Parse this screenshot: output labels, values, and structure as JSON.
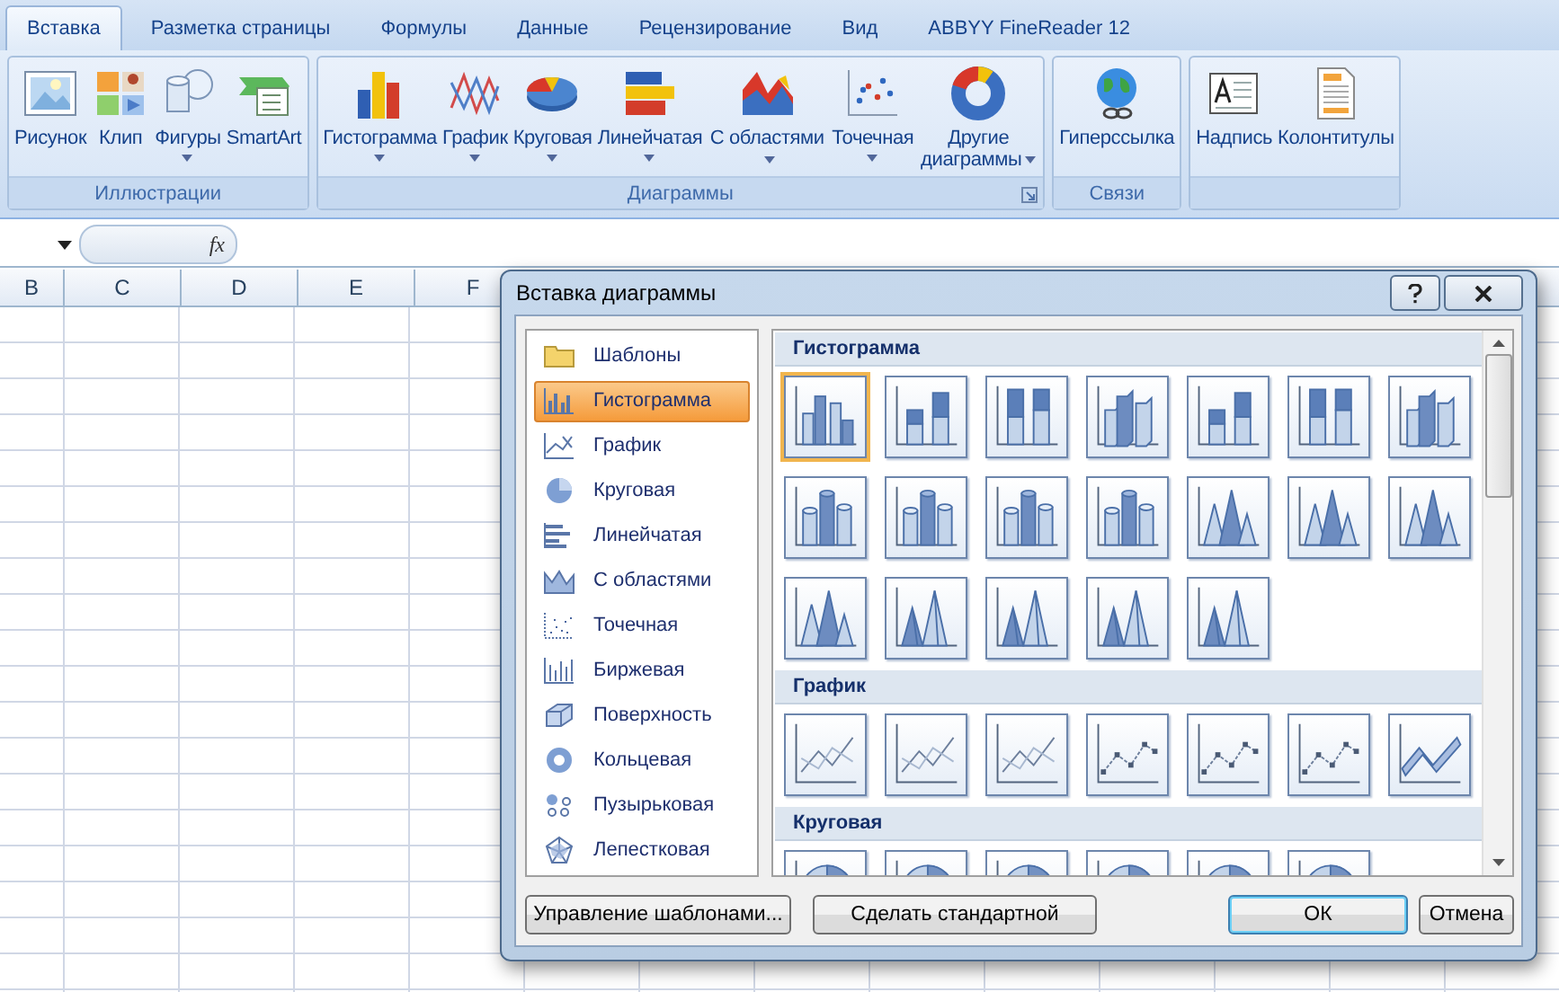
{
  "tabs": [
    {
      "label": "Вставка",
      "selected": true
    },
    {
      "label": "Разметка страницы",
      "selected": false
    },
    {
      "label": "Формулы",
      "selected": false
    },
    {
      "label": "Данные",
      "selected": false
    },
    {
      "label": "Рецензирование",
      "selected": false
    },
    {
      "label": "Вид",
      "selected": false
    },
    {
      "label": "ABBYY FineReader 12",
      "selected": false
    }
  ],
  "ribbon": {
    "groups": [
      {
        "title": "Иллюстрации",
        "buttons": [
          {
            "label": "Рисунок",
            "kind": "picture",
            "dropdown": false
          },
          {
            "label": "Клип",
            "kind": "clip",
            "dropdown": false
          },
          {
            "label": "Фигуры",
            "kind": "shapes",
            "dropdown": true
          },
          {
            "label": "SmartArt",
            "kind": "smartart",
            "dropdown": false
          }
        ]
      },
      {
        "title": "Диаграммы",
        "launcher": true,
        "buttons": [
          {
            "label": "Гистограмма",
            "kind": "column",
            "dropdown": true
          },
          {
            "label": "График",
            "kind": "line",
            "dropdown": true
          },
          {
            "label": "Круговая",
            "kind": "pie",
            "dropdown": true
          },
          {
            "label": "Линейчатая",
            "kind": "bar",
            "dropdown": true
          },
          {
            "label": "С областями",
            "kind": "area",
            "dropdown": true
          },
          {
            "label": "Точечная",
            "kind": "scatter",
            "dropdown": true
          },
          {
            "label": "Другие диаграммы",
            "kind": "donut",
            "dropdown": true
          }
        ]
      },
      {
        "title": "Связи",
        "buttons": [
          {
            "label": "Гиперссылка",
            "kind": "hyperlink",
            "dropdown": false
          }
        ]
      },
      {
        "buttons": [
          {
            "label": "Надпись",
            "kind": "textbox",
            "dropdown": false
          },
          {
            "label": "Колонтитулы",
            "kind": "header",
            "dropdown": false
          }
        ]
      }
    ]
  },
  "formula_bar": {
    "function_label": "fx"
  },
  "sheet": {
    "columns": [
      "B",
      "C",
      "D",
      "E",
      "F"
    ]
  },
  "dialog": {
    "title": "Вставка диаграммы",
    "categories": [
      {
        "label": "Шаблоны",
        "kind": "folder",
        "selected": false
      },
      {
        "label": "Гистограмма",
        "kind": "column",
        "selected": true
      },
      {
        "label": "График",
        "kind": "line",
        "selected": false
      },
      {
        "label": "Круговая",
        "kind": "pie",
        "selected": false
      },
      {
        "label": "Линейчатая",
        "kind": "bar",
        "selected": false
      },
      {
        "label": "С областями",
        "kind": "area",
        "selected": false
      },
      {
        "label": "Точечная",
        "kind": "scatter",
        "selected": false
      },
      {
        "label": "Биржевая",
        "kind": "stock",
        "selected": false
      },
      {
        "label": "Поверхность",
        "kind": "surface",
        "selected": false
      },
      {
        "label": "Кольцевая",
        "kind": "donut",
        "selected": false
      },
      {
        "label": "Пузырьковая",
        "kind": "bubble",
        "selected": false
      },
      {
        "label": "Лепестковая",
        "kind": "radar",
        "selected": false
      }
    ],
    "sections": [
      {
        "title": "Гистограмма",
        "charts": [
          {
            "kind": "column",
            "selected": true
          },
          {
            "kind": "column-stacked",
            "selected": false
          },
          {
            "kind": "column-full",
            "selected": false
          },
          {
            "kind": "column-3d",
            "selected": false
          },
          {
            "kind": "column-stacked",
            "selected": false
          },
          {
            "kind": "column-full",
            "selected": false
          },
          {
            "kind": "column-3d",
            "selected": false
          },
          {
            "kind": "cylinder",
            "selected": false
          },
          {
            "kind": "cylinder",
            "selected": false
          },
          {
            "kind": "cylinder",
            "selected": false
          },
          {
            "kind": "cylinder",
            "selected": false
          },
          {
            "kind": "cone",
            "selected": false
          },
          {
            "kind": "cone",
            "selected": false
          },
          {
            "kind": "cone",
            "selected": false
          },
          {
            "kind": "cone",
            "selected": false
          },
          {
            "kind": "pyramid",
            "selected": false
          },
          {
            "kind": "pyramid",
            "selected": false
          },
          {
            "kind": "pyramid",
            "selected": false
          },
          {
            "kind": "pyramid",
            "selected": false
          }
        ]
      },
      {
        "title": "График",
        "charts": [
          {
            "kind": "line",
            "selected": false
          },
          {
            "kind": "line",
            "selected": false
          },
          {
            "kind": "line",
            "selected": false
          },
          {
            "kind": "line-markers",
            "selected": false
          },
          {
            "kind": "line-markers",
            "selected": false
          },
          {
            "kind": "line-markers",
            "selected": false
          },
          {
            "kind": "line-3d",
            "selected": false
          }
        ]
      },
      {
        "title": "Круговая",
        "charts": [
          {
            "kind": "pie",
            "selected": false
          },
          {
            "kind": "pie",
            "selected": false
          },
          {
            "kind": "pie",
            "selected": false
          },
          {
            "kind": "pie",
            "selected": false
          },
          {
            "kind": "pie",
            "selected": false
          },
          {
            "kind": "pie",
            "selected": false
          }
        ]
      }
    ],
    "buttons": [
      {
        "label": "Управление шаблонами...",
        "kind": "secondary",
        "default": false
      },
      {
        "label": "Сделать стандартной",
        "kind": "secondary",
        "default": false
      },
      {
        "label": "ОК",
        "kind": "primary",
        "default": true
      },
      {
        "label": "Отмена",
        "kind": "primary",
        "default": false
      }
    ]
  }
}
